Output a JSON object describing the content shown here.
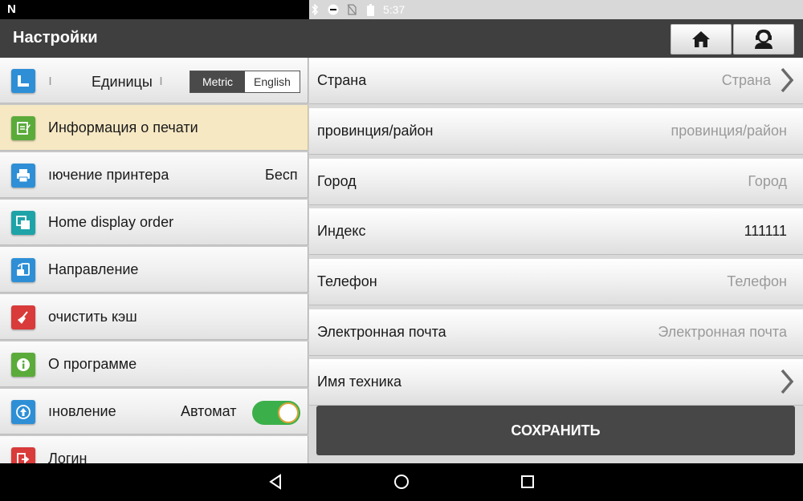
{
  "status_bar": {
    "time": "5:37",
    "icons": [
      "bluetooth-icon",
      "do-not-disturb-icon",
      "no-sim-icon",
      "battery-icon"
    ]
  },
  "app_bar": {
    "title": "Настройки",
    "buttons": [
      "home-icon",
      "support-icon"
    ]
  },
  "sidebar": {
    "items": [
      {
        "id": "units",
        "icon": "ruler-icon",
        "color": "#2e8fd6",
        "prefix": "ı",
        "label": "Единицы",
        "suffix": "ı",
        "segment": [
          "Metric",
          "English"
        ],
        "selected_segment": "Metric"
      },
      {
        "id": "print-info",
        "icon": "edit-note-icon",
        "color": "#5aab3a",
        "label": "Информация о печати",
        "selected": true
      },
      {
        "id": "printer-connection",
        "icon": "printer-icon",
        "color": "#2e8fd6",
        "label": "ıючение принтера",
        "value": "Бесп"
      },
      {
        "id": "home-order",
        "icon": "layers-icon",
        "color": "#1ea3a8",
        "label": "Home display order"
      },
      {
        "id": "direction",
        "icon": "tablet-rotate-icon",
        "color": "#2e8fd6",
        "label": "Направление"
      },
      {
        "id": "clear-cache",
        "icon": "broom-icon",
        "color": "#d93a3a",
        "label": "очистить кэш"
      },
      {
        "id": "about",
        "icon": "info-icon",
        "color": "#5aab3a",
        "label": "О программе"
      },
      {
        "id": "update",
        "icon": "upload-icon",
        "color": "#2e8fd6",
        "label": "ıновление",
        "value": "Автомат",
        "toggle_on": true
      },
      {
        "id": "login",
        "icon": "logout-icon",
        "color": "#d93a3a",
        "label": "Логин"
      }
    ]
  },
  "form": {
    "fields": [
      {
        "id": "country",
        "label": "Страна",
        "value": "Страна",
        "placeholder": true,
        "chevron": true
      },
      {
        "id": "province",
        "label": "провинция/район",
        "value": "провинция/район",
        "placeholder": true
      },
      {
        "id": "city",
        "label": "Город",
        "value": "Город",
        "placeholder": true
      },
      {
        "id": "zip",
        "label": "Индекс",
        "value": "111111",
        "placeholder": false
      },
      {
        "id": "phone",
        "label": "Телефон",
        "value": "Телефон",
        "placeholder": true
      },
      {
        "id": "email",
        "label": "Электронная почта",
        "value": "Электронная почта",
        "placeholder": true
      },
      {
        "id": "technician",
        "label": "Имя техника",
        "value": "",
        "chevron": true
      }
    ],
    "save_label": "СОХРАНИТЬ"
  },
  "colors": {
    "app_bar": "#3f3f3f",
    "selected_row": "#f6e8c3",
    "toggle_on": "#3bb04a",
    "save_button": "#474747"
  }
}
